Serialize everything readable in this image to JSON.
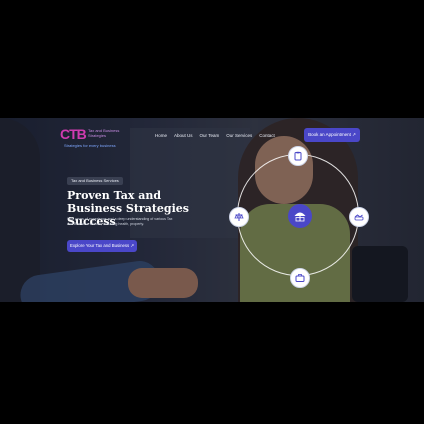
{
  "logo": {
    "mark": "CTB",
    "name": "Tax and Business Strategies",
    "tagline": "Strategies for every business"
  },
  "nav": {
    "items": [
      "Home",
      "About Us",
      "Our Team",
      "Our Services",
      "Contact"
    ],
    "cta": "Book an Appointment ↗"
  },
  "hero": {
    "badge": "Tax and Business Services",
    "title": "Proven Tax and Business Strategies Success",
    "description": "With years of experience and a deep understanding of various Tax and Business sectors, including health, property.",
    "cta": "Explore Your Tax and Business ↗"
  },
  "icons": {
    "top": "clipboard-icon",
    "left": "scale-icon",
    "right": "handshake-icon",
    "bottom": "briefcase-icon",
    "center": "umbrella-icon"
  },
  "colors": {
    "accent": "#4a47c8",
    "logo_pink": "#d03bb0"
  }
}
